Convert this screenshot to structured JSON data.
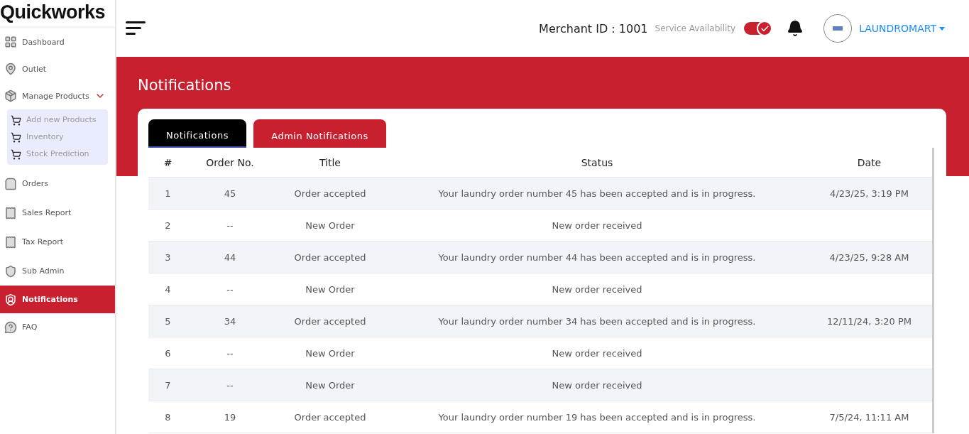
{
  "brand": "Quickworks",
  "sidebar": {
    "items": [
      {
        "label": "Dashboard",
        "selected": false
      },
      {
        "label": "Outlet",
        "selected": false
      },
      {
        "label": "Manage Products",
        "selected": false,
        "expanded": true,
        "children": [
          {
            "label": "Add new Products",
            "selected": false
          },
          {
            "label": "Inventory",
            "selected": false
          },
          {
            "label": "Stock Prediction",
            "selected": false
          }
        ]
      },
      {
        "label": "Orders",
        "selected": false
      },
      {
        "label": "Sales Report",
        "selected": false
      },
      {
        "label": "Tax Report",
        "selected": false
      },
      {
        "label": "Sub Admin",
        "selected": false
      },
      {
        "label": "Notifications",
        "selected": true
      },
      {
        "label": "FAQ",
        "selected": false
      }
    ]
  },
  "header": {
    "merchant_id": "Merchant ID : 1001",
    "service_label": "Service Availability",
    "service_on": true,
    "account": "LAUNDROMART"
  },
  "page_title": "Notifications",
  "tabs": [
    {
      "label": "Notifications",
      "selected": true
    },
    {
      "label": "Admin Notifications",
      "selected": false
    }
  ],
  "table": {
    "columns": [
      "#",
      "Order No.",
      "Title",
      "Status",
      "Date"
    ],
    "rows": [
      [
        "1",
        "45",
        "Order accepted",
        "Your laundry order number 45 has been accepted and is in progress.",
        "4/23/25, 3:19 PM"
      ],
      [
        "2",
        "--",
        "New Order",
        "New order received",
        ""
      ],
      [
        "3",
        "44",
        "Order accepted",
        "Your laundry order number 44 has been accepted and is in progress.",
        "4/23/25, 9:28 AM"
      ],
      [
        "4",
        "--",
        "New Order",
        "New order received",
        ""
      ],
      [
        "5",
        "34",
        "Order accepted",
        "Your laundry order number 34 has been accepted and is in progress.",
        "12/11/24, 3:20 PM"
      ],
      [
        "6",
        "--",
        "New Order",
        "New order received",
        ""
      ],
      [
        "7",
        "--",
        "New Order",
        "New order received",
        ""
      ],
      [
        "8",
        "19",
        "Order accepted",
        "Your laundry order number 19 has been accepted and is in progress.",
        "7/5/24, 11:11 AM"
      ]
    ]
  }
}
